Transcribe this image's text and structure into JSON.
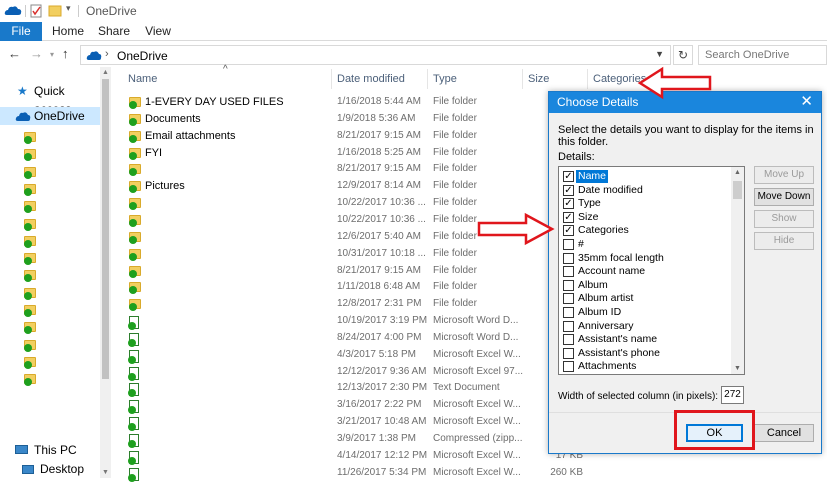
{
  "window": {
    "title": "OneDrive"
  },
  "ribbon": {
    "tabs": [
      "File",
      "Home",
      "Share",
      "View"
    ]
  },
  "address": {
    "crumb": "OneDrive",
    "search_placeholder": "Search OneDrive"
  },
  "nav": {
    "quick_access": "Quick access",
    "onedrive": "OneDrive",
    "this_pc": "This PC",
    "desktop": "Desktop"
  },
  "columns": {
    "name": "Name",
    "date": "Date modified",
    "type": "Type",
    "size": "Size",
    "categories": "Categories"
  },
  "files": [
    {
      "name": "1-EVERY DAY USED FILES",
      "date": "1/16/2018 5:44 AM",
      "type": "File folder",
      "size": "",
      "icon": "folder"
    },
    {
      "name": "Documents",
      "date": "1/9/2018 5:36 AM",
      "type": "File folder",
      "size": "",
      "icon": "folder"
    },
    {
      "name": "Email attachments",
      "date": "8/21/2017 9:15 AM",
      "type": "File folder",
      "size": "",
      "icon": "folder"
    },
    {
      "name": "FYI",
      "date": "1/16/2018 5:25 AM",
      "type": "File folder",
      "size": "",
      "icon": "folder"
    },
    {
      "name": "",
      "date": "8/21/2017 9:15 AM",
      "type": "File folder",
      "size": "",
      "icon": "folder"
    },
    {
      "name": "Pictures",
      "date": "12/9/2017 8:14 AM",
      "type": "File folder",
      "size": "",
      "icon": "folder"
    },
    {
      "name": "",
      "date": "10/22/2017 10:36 ...",
      "type": "File folder",
      "size": "",
      "icon": "folder"
    },
    {
      "name": "",
      "date": "10/22/2017 10:36 ...",
      "type": "File folder",
      "size": "",
      "icon": "folder"
    },
    {
      "name": "",
      "date": "12/6/2017 5:40 AM",
      "type": "File folder",
      "size": "",
      "icon": "folder"
    },
    {
      "name": "",
      "date": "10/31/2017 10:18 ...",
      "type": "File folder",
      "size": "",
      "icon": "folder"
    },
    {
      "name": "",
      "date": "8/21/2017 9:15 AM",
      "type": "File folder",
      "size": "",
      "icon": "folder"
    },
    {
      "name": "",
      "date": "1/11/2018 6:48 AM",
      "type": "File folder",
      "size": "",
      "icon": "folder"
    },
    {
      "name": "",
      "date": "12/8/2017 2:31 PM",
      "type": "File folder",
      "size": "",
      "icon": "folder"
    },
    {
      "name": "",
      "date": "10/19/2017 3:19 PM",
      "type": "Microsoft Word D...",
      "size": "",
      "icon": "word"
    },
    {
      "name": "",
      "date": "8/24/2017 4:00 PM",
      "type": "Microsoft Word D...",
      "size": "",
      "icon": "word"
    },
    {
      "name": "",
      "date": "4/3/2017 5:18 PM",
      "type": "Microsoft Excel W...",
      "size": "",
      "icon": "excel"
    },
    {
      "name": "",
      "date": "12/12/2017 9:36 AM",
      "type": "Microsoft Excel 97...",
      "size": "",
      "icon": "excel"
    },
    {
      "name": "",
      "date": "12/13/2017 2:30 PM",
      "type": "Text Document",
      "size": "",
      "icon": "text"
    },
    {
      "name": "",
      "date": "3/16/2017 2:22 PM",
      "type": "Microsoft Excel W...",
      "size": "",
      "icon": "excel"
    },
    {
      "name": "",
      "date": "3/21/2017 10:48 AM",
      "type": "Microsoft Excel W...",
      "size": "",
      "icon": "excel"
    },
    {
      "name": "",
      "date": "3/9/2017 1:38 PM",
      "type": "Compressed (zipp...",
      "size": "",
      "icon": "zip"
    },
    {
      "name": "",
      "date": "4/14/2017 12:12 PM",
      "type": "Microsoft Excel W...",
      "size": "17 KB",
      "icon": "excel"
    },
    {
      "name": "",
      "date": "11/26/2017 5:34 PM",
      "type": "Microsoft Excel W...",
      "size": "260 KB",
      "icon": "excel"
    }
  ],
  "dialog": {
    "title": "Choose Details",
    "description": "Select the details you want to display for the items in this folder.",
    "details_label": "Details:",
    "items": [
      {
        "label": "Name",
        "checked": true,
        "selected": true
      },
      {
        "label": "Date modified",
        "checked": true
      },
      {
        "label": "Type",
        "checked": true
      },
      {
        "label": "Size",
        "checked": true
      },
      {
        "label": "Categories",
        "checked": true
      },
      {
        "label": "#",
        "checked": false
      },
      {
        "label": "35mm focal length",
        "checked": false
      },
      {
        "label": "Account name",
        "checked": false
      },
      {
        "label": "Album",
        "checked": false
      },
      {
        "label": "Album artist",
        "checked": false
      },
      {
        "label": "Album ID",
        "checked": false
      },
      {
        "label": "Anniversary",
        "checked": false
      },
      {
        "label": "Assistant's name",
        "checked": false
      },
      {
        "label": "Assistant's phone",
        "checked": false
      },
      {
        "label": "Attachments",
        "checked": false
      }
    ],
    "buttons": {
      "move_up": "Move Up",
      "move_down": "Move Down",
      "show": "Show",
      "hide": "Hide"
    },
    "width_label": "Width of selected column (in pixels):",
    "width_value": "272",
    "ok": "OK",
    "cancel": "Cancel"
  },
  "colors": {
    "accent": "#1979ca",
    "dialog_title": "#1a86dd",
    "annotation": "#e0161c"
  }
}
